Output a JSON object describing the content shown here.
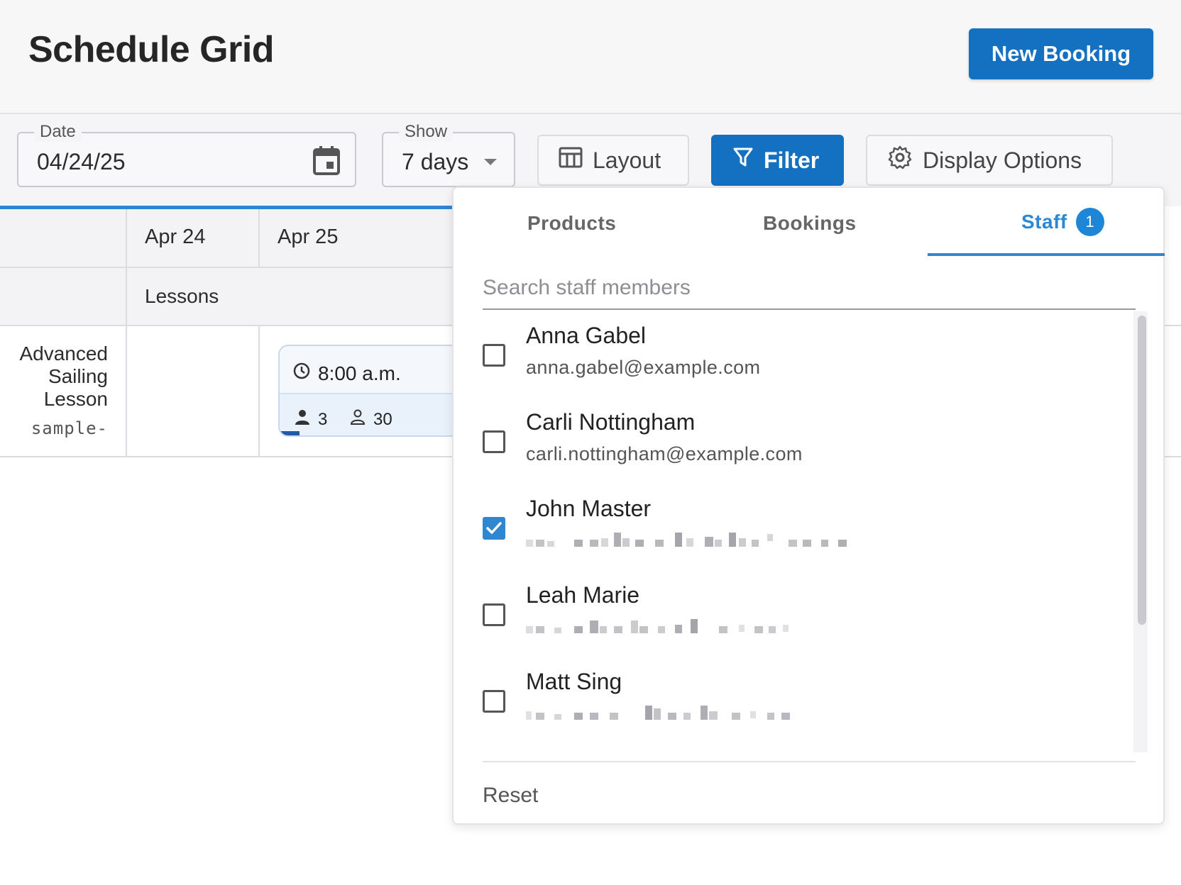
{
  "header": {
    "title": "Schedule Grid",
    "new_booking_label": "New Booking"
  },
  "toolbar": {
    "date": {
      "label": "Date",
      "value": "04/24/25"
    },
    "show": {
      "label": "Show",
      "value": "7 days"
    },
    "layout_label": "Layout",
    "filter_label": "Filter",
    "display_options_label": "Display Options"
  },
  "grid": {
    "columns": [
      "Apr 24",
      "Apr 25"
    ],
    "group_label": "Lessons",
    "row": {
      "title_lines": [
        "Advanced",
        "Sailing",
        "Lesson"
      ],
      "subtitle": "sample-"
    },
    "event": {
      "time": "8:00 a.m.",
      "booked": "3",
      "capacity": "30"
    }
  },
  "filter_panel": {
    "tabs": [
      {
        "label": "Products"
      },
      {
        "label": "Bookings"
      },
      {
        "label": "Staff",
        "badge": "1",
        "active": true
      }
    ],
    "search_placeholder": "Search staff members",
    "staff": [
      {
        "name": "Anna Gabel",
        "email": "anna.gabel@example.com",
        "checked": false
      },
      {
        "name": "Carli Nottingham",
        "email": "carli.nottingham@example.com",
        "checked": false
      },
      {
        "name": "John Master",
        "email": "",
        "checked": true
      },
      {
        "name": "Leah Marie",
        "email": "",
        "checked": false
      },
      {
        "name": "Matt Sing",
        "email": "",
        "checked": false
      }
    ],
    "reset_label": "Reset"
  },
  "colors": {
    "primary": "#1471c1",
    "accent": "#2f87d1",
    "badge": "#1e86d6"
  }
}
